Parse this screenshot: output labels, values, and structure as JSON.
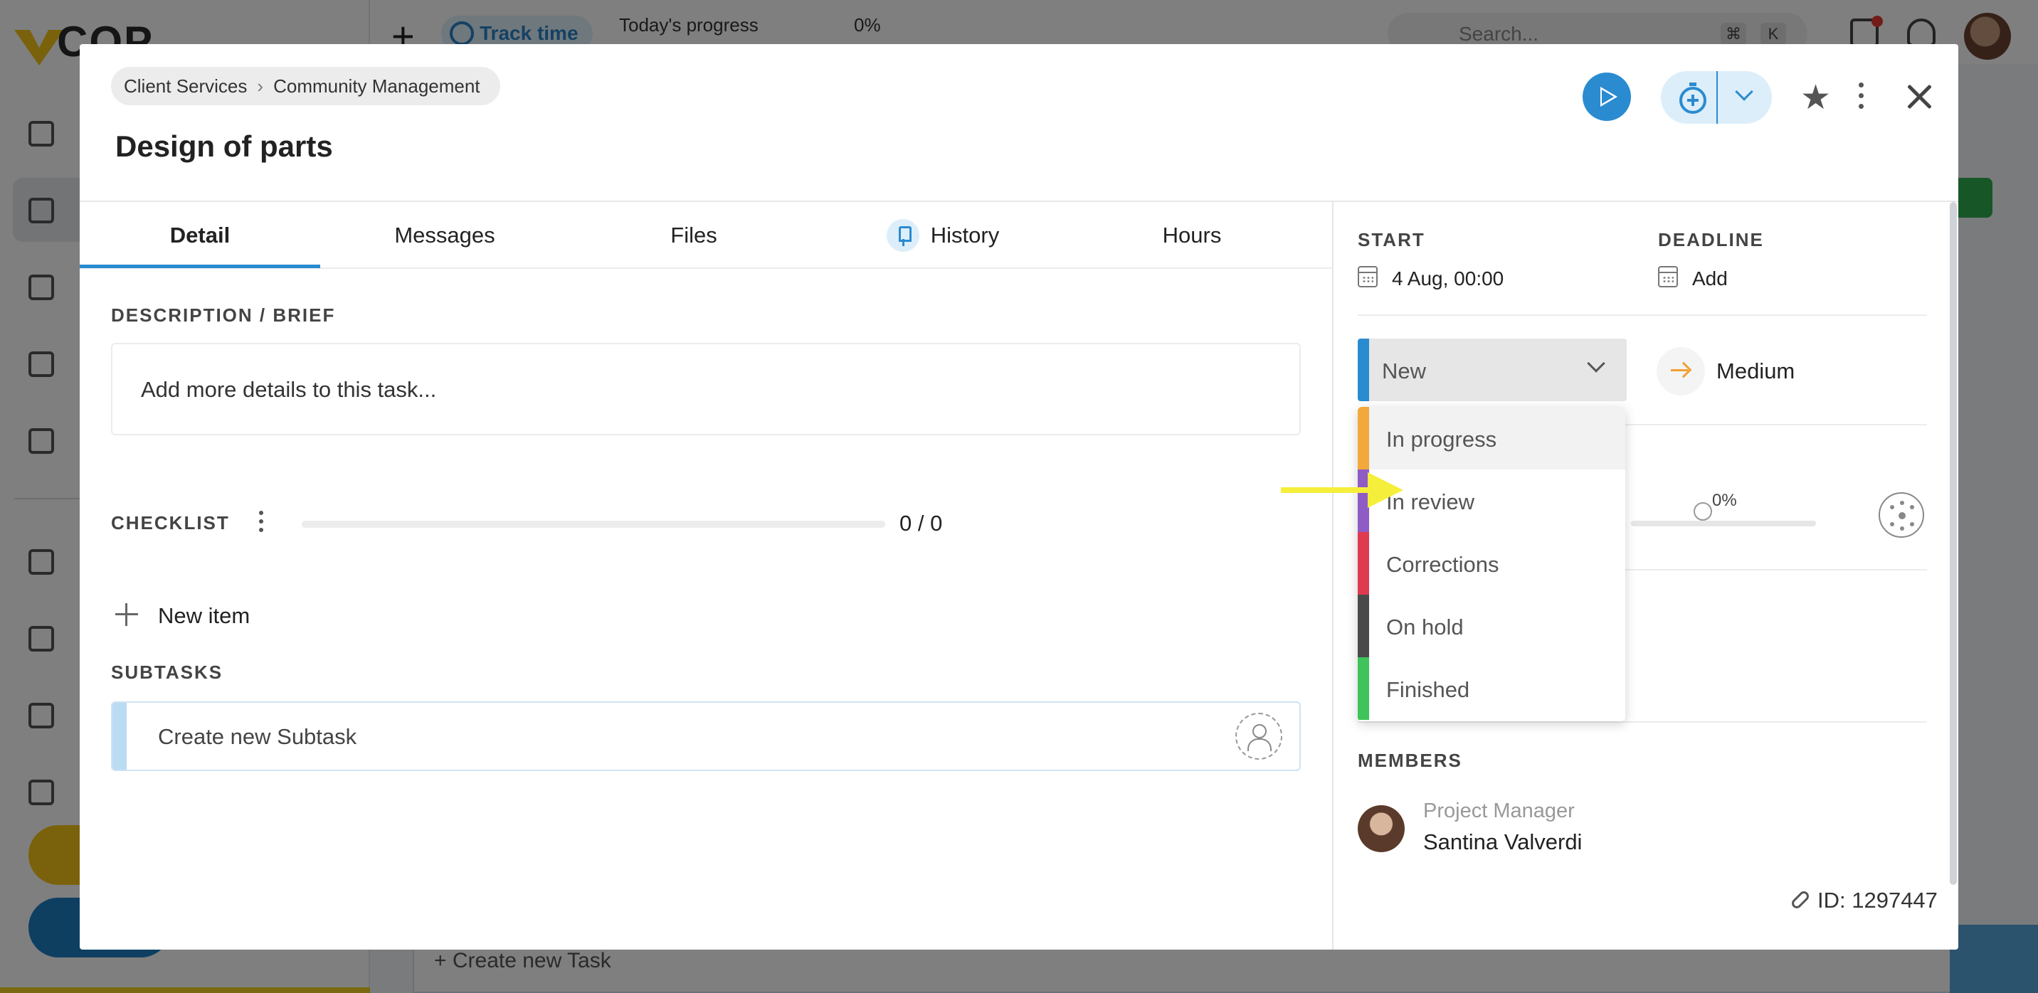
{
  "background_app": {
    "logo_text": "COP",
    "track_time_label": "Track time",
    "todays_progress_label": "Today's progress",
    "todays_progress_value": "0%",
    "search_placeholder": "Search...",
    "kbd_keys": [
      "⌘",
      "K"
    ],
    "create_task_label": "+ Create new Task"
  },
  "modal": {
    "breadcrumb": [
      "Client Services",
      "Community Management"
    ],
    "title": "Design of parts",
    "header_icons": [
      "play-icon",
      "timer-icon",
      "chevron-down-icon",
      "star-icon",
      "kebab-icon",
      "close-icon"
    ],
    "tabs": [
      {
        "label": "Detail",
        "active": true
      },
      {
        "label": "Messages",
        "active": false
      },
      {
        "label": "Files",
        "active": false
      },
      {
        "label": "History",
        "active": false,
        "icon": "pin-icon"
      },
      {
        "label": "Hours",
        "active": false
      }
    ],
    "description": {
      "label": "DESCRIPTION / BRIEF",
      "placeholder": "Add more details to this task..."
    },
    "checklist": {
      "label": "CHECKLIST",
      "count": "0 / 0",
      "progress": 0,
      "new_item_label": "New item"
    },
    "subtasks": {
      "label": "SUBTASKS",
      "placeholder": "Create new Subtask"
    },
    "sidebar": {
      "start_label": "START",
      "start_value": "4 Aug, 00:00",
      "deadline_label": "DEADLINE",
      "deadline_value": "Add",
      "status": {
        "current": "New",
        "current_color": "#2a8bd0",
        "options": [
          {
            "label": "In progress",
            "color": "#f2a93b",
            "highlighted": true
          },
          {
            "label": "In review",
            "color": "#8e5cc4",
            "highlighted": false
          },
          {
            "label": "Corrections",
            "color": "#e03a4e",
            "highlighted": false
          },
          {
            "label": "On hold",
            "color": "#4a4a4a",
            "highlighted": false
          },
          {
            "label": "Finished",
            "color": "#3ec45a",
            "highlighted": false
          }
        ]
      },
      "priority": {
        "label": "Medium",
        "color": "#f0a030"
      },
      "progress": {
        "value_text": "0%",
        "fraction": 0
      },
      "members_label": "MEMBERS",
      "members": [
        {
          "role": "Project Manager",
          "name": "Santina Valverdi"
        }
      ],
      "task_id": "ID: 1297447"
    }
  },
  "annotation": {
    "arrow_color": "#f5ef3c",
    "points_to": "In progress"
  }
}
